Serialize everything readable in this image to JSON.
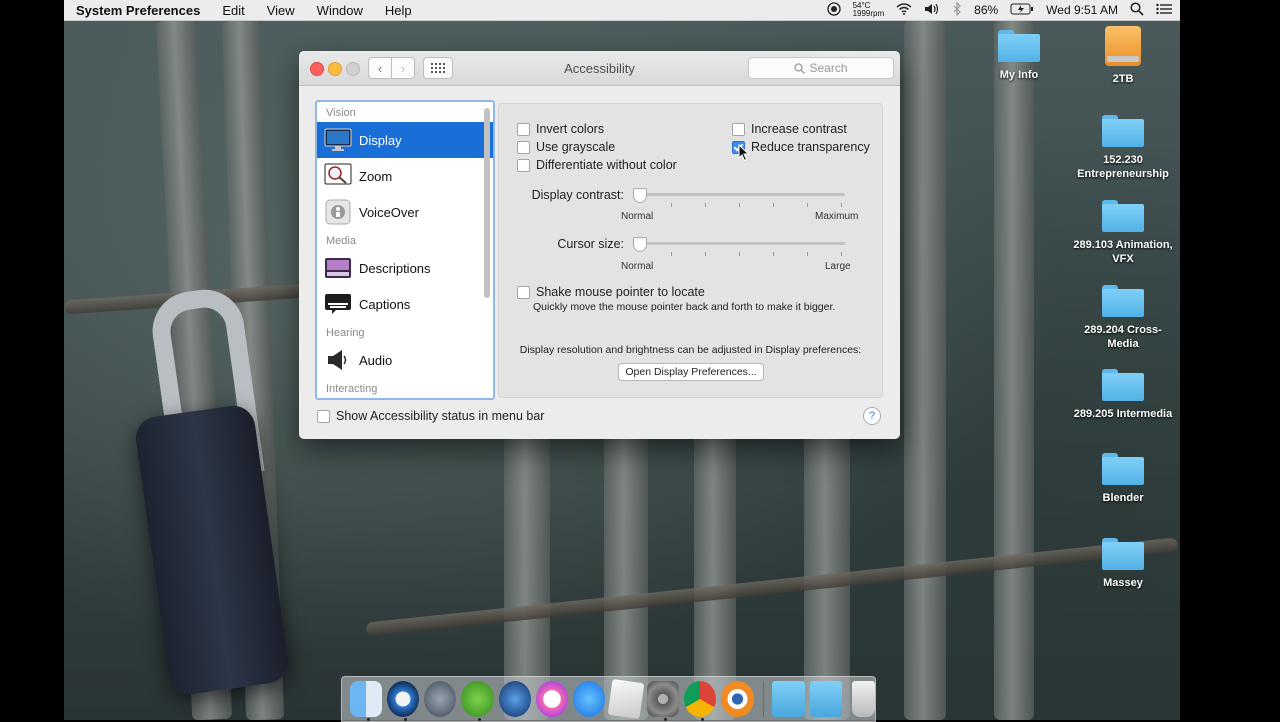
{
  "menubar": {
    "app": "System Preferences",
    "menus": [
      "Edit",
      "View",
      "Window",
      "Help"
    ],
    "temp_c": "54°C",
    "rpm": "1999rpm",
    "battery": "86%",
    "clock": "Wed 9:51 AM"
  },
  "desktop_icons": [
    {
      "label": "My Info",
      "kind": "folder"
    },
    {
      "label": "2TB",
      "kind": "drive"
    },
    {
      "label": "152.230 Entrepreneurship",
      "kind": "folder"
    },
    {
      "label": "289.103 Animation, VFX",
      "kind": "folder"
    },
    {
      "label": "289.204 Cross-Media",
      "kind": "folder"
    },
    {
      "label": "289.205 Intermedia",
      "kind": "folder"
    },
    {
      "label": "Blender",
      "kind": "folder"
    },
    {
      "label": "Massey",
      "kind": "folder"
    }
  ],
  "window": {
    "title": "Accessibility",
    "search_placeholder": "Search",
    "sidebar": {
      "sections": {
        "vision": "Vision",
        "media": "Media",
        "hearing": "Hearing",
        "interacting": "Interacting"
      },
      "items": {
        "display": "Display",
        "zoom": "Zoom",
        "voiceover": "VoiceOver",
        "descriptions": "Descriptions",
        "captions": "Captions",
        "audio": "Audio"
      },
      "selected": "Display"
    },
    "display": {
      "invert_colors": {
        "label": "Invert colors",
        "checked": false
      },
      "use_grayscale": {
        "label": "Use grayscale",
        "checked": false
      },
      "differentiate": {
        "label": "Differentiate without color",
        "checked": false
      },
      "increase_contrast": {
        "label": "Increase contrast",
        "checked": false
      },
      "reduce_transparency": {
        "label": "Reduce transparency",
        "checked": true
      },
      "contrast_slider": {
        "label": "Display contrast:",
        "min_label": "Normal",
        "max_label": "Maximum",
        "value": 0
      },
      "cursor_slider": {
        "label": "Cursor size:",
        "min_label": "Normal",
        "max_label": "Large",
        "value": 0
      },
      "shake": {
        "label": "Shake mouse pointer to locate",
        "checked": false,
        "hint": "Quickly move the mouse pointer back and forth to make it bigger."
      },
      "resolution_note": "Display resolution and brightness can be adjusted in Display preferences:",
      "open_prefs_button": "Open Display Preferences..."
    },
    "footer": {
      "show_status": {
        "label": "Show Accessibility status in menu bar",
        "checked": false
      },
      "help": "?"
    }
  },
  "dock": {
    "apps": [
      "finder",
      "quicktime",
      "launchpad",
      "utorrent",
      "quicktime-x",
      "itunes",
      "app-store",
      "preview",
      "system-preferences",
      "chrome",
      "blender"
    ],
    "after_separator": [
      "folder-stack",
      "downloads",
      "trash"
    ]
  }
}
